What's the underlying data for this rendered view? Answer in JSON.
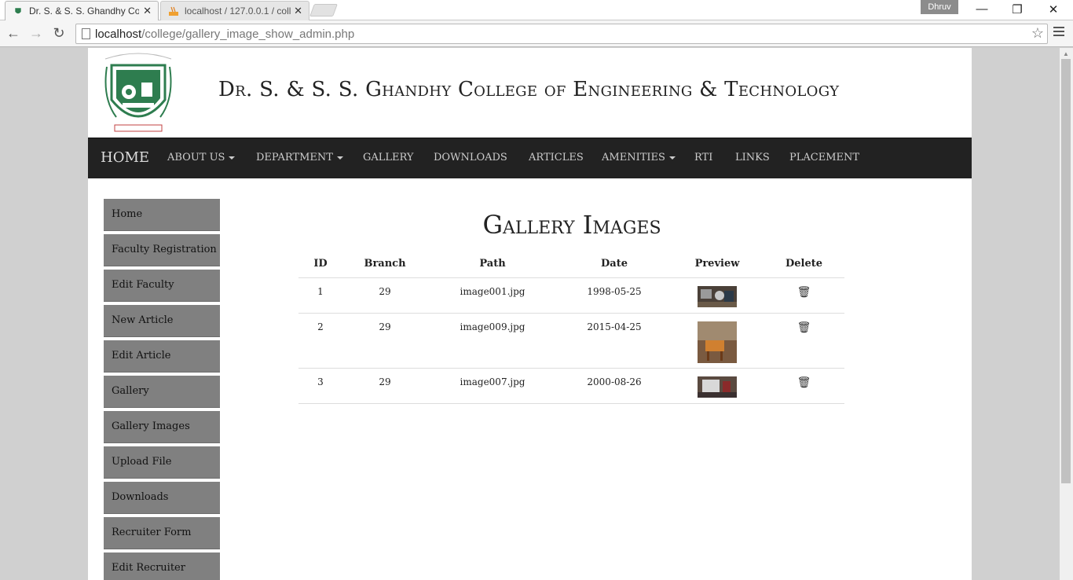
{
  "browser": {
    "tabs": [
      {
        "title": "Dr. S. & S. S. Ghandhy Col",
        "active": true
      },
      {
        "title": "localhost / 127.0.0.1 / coll",
        "active": false
      }
    ],
    "profile": "Dhruv",
    "url_host": "localhost",
    "url_path": "/college/gallery_image_show_admin.php",
    "window_controls": {
      "minimize": "—",
      "restore": "❐",
      "close": "✕"
    }
  },
  "header": {
    "college_name": "Dr. S. & S. S. Ghandhy College of Engineering & Technology"
  },
  "navbar": {
    "items": [
      {
        "label": "HOME",
        "dropdown": false
      },
      {
        "label": "ABOUT US",
        "dropdown": true
      },
      {
        "label": "DEPARTMENT",
        "dropdown": true
      },
      {
        "label": "GALLERY",
        "dropdown": false
      },
      {
        "label": "DOWNLOADS",
        "dropdown": false
      },
      {
        "label": "ARTICLES",
        "dropdown": false
      },
      {
        "label": "AMENITIES",
        "dropdown": true
      },
      {
        "label": "RTI",
        "dropdown": false
      },
      {
        "label": "LINKS",
        "dropdown": false
      },
      {
        "label": "PLACEMENT",
        "dropdown": false
      }
    ]
  },
  "sidebar": {
    "items": [
      {
        "label": "Home"
      },
      {
        "label": "Faculty Registration"
      },
      {
        "label": "Edit Faculty"
      },
      {
        "label": "New Article"
      },
      {
        "label": "Edit Article"
      },
      {
        "label": "Gallery"
      },
      {
        "label": "Gallery Images"
      },
      {
        "label": "Upload File"
      },
      {
        "label": "Downloads"
      },
      {
        "label": "Recruiter Form"
      },
      {
        "label": "Edit Recruiter"
      }
    ]
  },
  "main": {
    "title": "Gallery Images",
    "table": {
      "columns": [
        "ID",
        "Branch",
        "Path",
        "Date",
        "Preview",
        "Delete"
      ],
      "rows": [
        {
          "id": "1",
          "branch": "29",
          "path": "image001.jpg",
          "date": "1998-05-25"
        },
        {
          "id": "2",
          "branch": "29",
          "path": "image009.jpg",
          "date": "2015-04-25"
        },
        {
          "id": "3",
          "branch": "29",
          "path": "image007.jpg",
          "date": "2000-08-26"
        }
      ]
    }
  }
}
